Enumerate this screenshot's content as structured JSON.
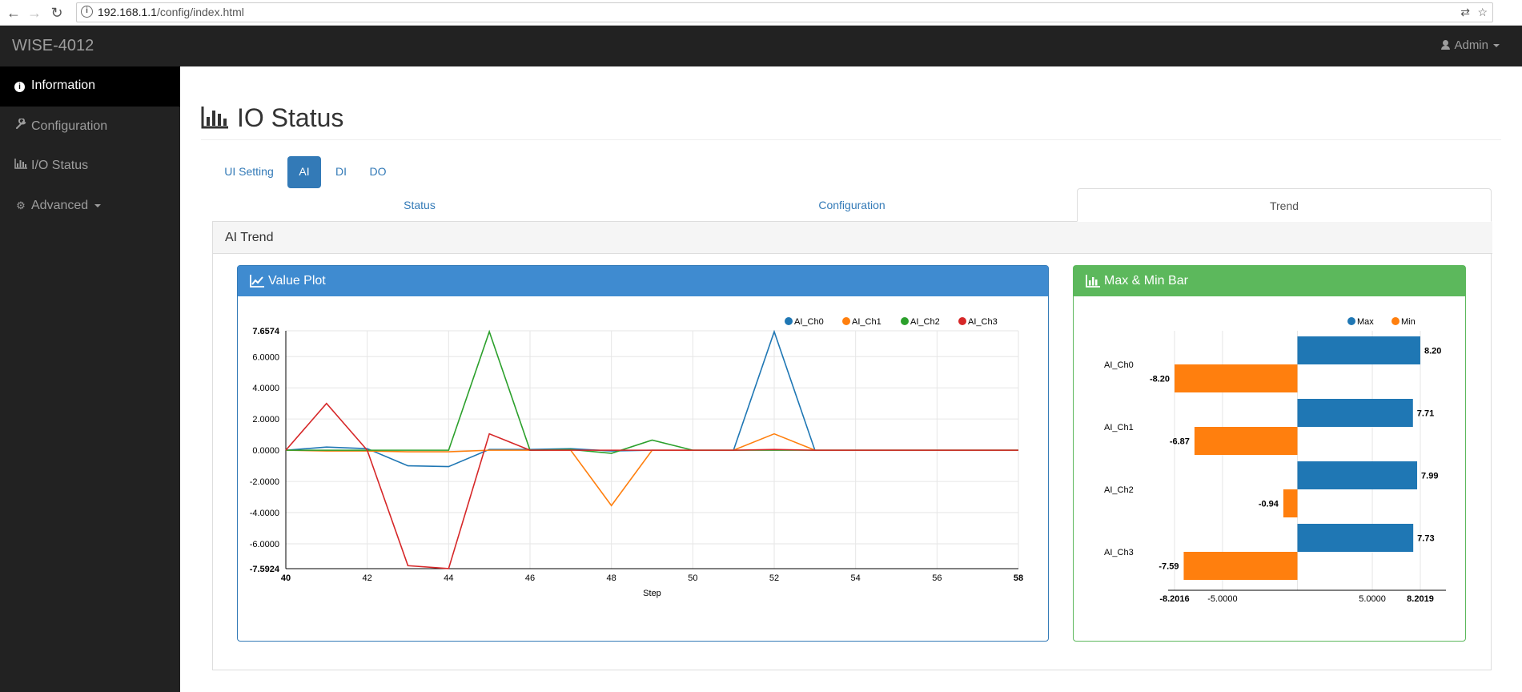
{
  "browser": {
    "url_host": "192.168.1.1",
    "url_path": "/config/index.html"
  },
  "navbar": {
    "brand": "WISE-4012",
    "user": "Admin"
  },
  "sidebar": {
    "items": [
      {
        "label": "Information",
        "icon": "info-circle-icon",
        "active": true
      },
      {
        "label": "Configuration",
        "icon": "wrench-icon",
        "active": false
      },
      {
        "label": "I/O Status",
        "icon": "bar-chart-icon",
        "active": false
      },
      {
        "label": "Advanced",
        "icon": "gears-icon",
        "active": false
      }
    ]
  },
  "page": {
    "title": "IO Status",
    "pills": [
      "UI Setting",
      "AI",
      "DI",
      "DO"
    ],
    "active_pill": "AI",
    "tabs": [
      "Status",
      "Configuration",
      "Trend"
    ],
    "active_tab": "Trend",
    "section_title": "AI Trend",
    "value_plot_title": "Value Plot",
    "bar_title": "Max & Min Bar"
  },
  "colors": {
    "AI_Ch0": "#1f77b4",
    "AI_Ch1": "#ff7f0e",
    "AI_Ch2": "#2ca02c",
    "AI_Ch3": "#d62728",
    "primary": "#337ab7",
    "success": "#5cb85c"
  },
  "chart_data": [
    {
      "type": "line",
      "xlabel": "Step",
      "ylabel": "",
      "xlim": [
        40,
        58
      ],
      "ylim": [
        -7.5924,
        7.6574
      ],
      "x_ticks": [
        40,
        42,
        44,
        46,
        48,
        50,
        52,
        54,
        56,
        58
      ],
      "y_ticks": [
        "7.6574",
        "6.0000",
        "4.0000",
        "2.0000",
        "0.0000",
        "-2.0000",
        "-4.0000",
        "-6.0000",
        "-7.5924"
      ],
      "y_tick_values": [
        7.6574,
        6,
        4,
        2,
        0,
        -2,
        -4,
        -6,
        -7.5924
      ],
      "grid": true,
      "legend": "top-right",
      "x": [
        40,
        41,
        42,
        43,
        44,
        45,
        46,
        47,
        48,
        49,
        50,
        51,
        52,
        53,
        54,
        55,
        56,
        57,
        58
      ],
      "series": [
        {
          "name": "AI_Ch0",
          "values": [
            0,
            0.2,
            0.1,
            -1.0,
            -1.05,
            0.05,
            0.05,
            0.1,
            -0.05,
            0,
            0,
            0,
            7.6,
            0,
            0,
            0,
            0,
            0,
            0
          ]
        },
        {
          "name": "AI_Ch1",
          "values": [
            0,
            -0.05,
            -0.05,
            -0.1,
            -0.1,
            0,
            0,
            0,
            -3.55,
            0,
            0,
            0,
            1.05,
            0,
            0,
            0,
            0,
            0,
            0
          ]
        },
        {
          "name": "AI_Ch2",
          "values": [
            0,
            0,
            0,
            0,
            0,
            7.6,
            0,
            0.05,
            -0.2,
            0.65,
            0,
            0,
            0,
            0,
            0,
            0,
            0,
            0,
            0
          ]
        },
        {
          "name": "AI_Ch3",
          "values": [
            0,
            3.0,
            0,
            -7.4,
            -7.59,
            1.05,
            0,
            0,
            0,
            0,
            0,
            0,
            0.05,
            0,
            0,
            0,
            0,
            0,
            0
          ]
        }
      ]
    },
    {
      "type": "bar",
      "orientation": "horizontal",
      "categories": [
        "AI_Ch0",
        "AI_Ch1",
        "AI_Ch2",
        "AI_Ch3"
      ],
      "series": [
        {
          "name": "Max",
          "values": [
            8.2,
            7.71,
            7.99,
            7.73
          ],
          "labels": [
            "8.20",
            "7.71",
            "7.99",
            "7.73"
          ]
        },
        {
          "name": "Min",
          "values": [
            -8.2,
            -6.87,
            -0.94,
            -7.59
          ],
          "labels": [
            "-8.20",
            "-6.87",
            "-0.94",
            "-7.59"
          ]
        }
      ],
      "xlim": [
        -8.2016,
        8.2019
      ],
      "x_ticks": [
        "-8.2016",
        "-5.0000",
        "5.0000",
        "8.2019"
      ],
      "x_tick_values": [
        -8.2016,
        -5,
        5,
        8.2019
      ],
      "grid": true,
      "legend": "top-right"
    }
  ]
}
